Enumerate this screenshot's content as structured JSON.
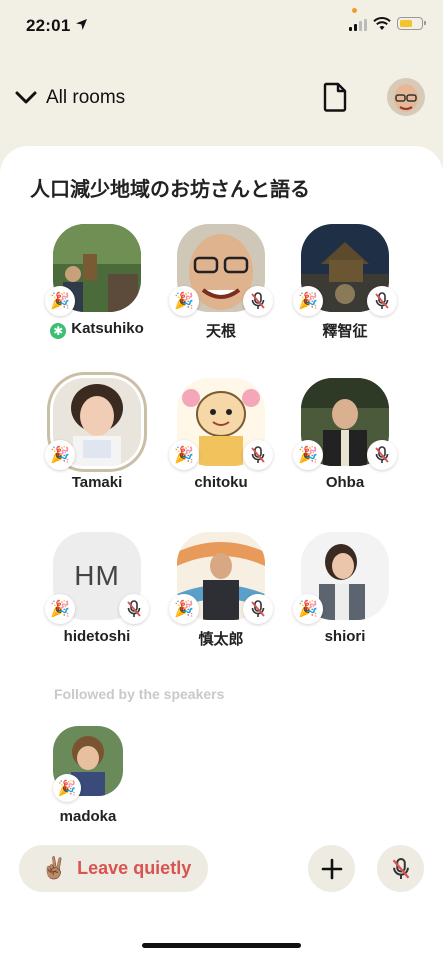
{
  "status_bar": {
    "time": "22:01"
  },
  "header": {
    "back_label": "All rooms",
    "doc_icon": "document-icon",
    "profile": "profile-avatar"
  },
  "room": {
    "title": "人口減少地域のお坊さんと語る",
    "speakers": [
      {
        "name": "Katsuhiko",
        "moderator_icon": "✱",
        "muted": false
      },
      {
        "name": "天根",
        "muted": true
      },
      {
        "name": "釋智征",
        "muted": true
      },
      {
        "name": "Tamaki",
        "muted": false
      },
      {
        "name": "chitoku",
        "muted": true
      },
      {
        "name": "Ohba",
        "muted": true
      },
      {
        "name": "hidetoshi",
        "initials": "HM",
        "muted": true
      },
      {
        "name": "慎太郎",
        "muted": true
      },
      {
        "name": "shiori",
        "muted": false
      }
    ],
    "followed_label": "Followed by the speakers",
    "listeners": [
      {
        "name": "madoka"
      }
    ]
  },
  "bottom_bar": {
    "leave_emoji": "✌🏽",
    "leave_label": "Leave quietly",
    "add_icon": "plus-icon",
    "mic_icon": "mic-muted-icon"
  },
  "colors": {
    "background": "#f2efe4",
    "leave_text": "#d9534f",
    "moderator_badge": "#3cbf72",
    "mute_red": "#d9534f"
  }
}
